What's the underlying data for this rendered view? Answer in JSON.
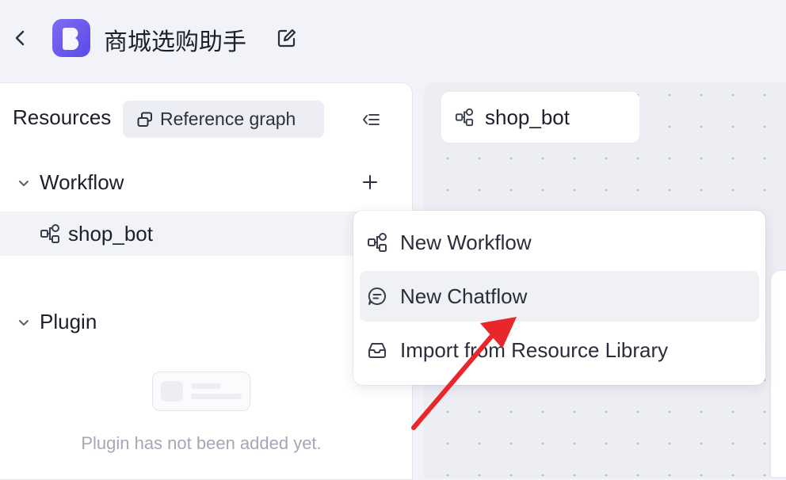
{
  "header": {
    "app_title": "商城选购助手"
  },
  "sidebar": {
    "title": "Resources",
    "reference_graph_label": "Reference graph",
    "sections": [
      {
        "label": "Workflow",
        "items": [
          {
            "label": "shop_bot"
          }
        ]
      },
      {
        "label": "Plugin",
        "empty_text": "Plugin has not been added yet."
      }
    ]
  },
  "canvas": {
    "tab_label": "shop_bot"
  },
  "add_menu": {
    "items": [
      {
        "label": "New Workflow",
        "icon": "workflow-icon"
      },
      {
        "label": "New Chatflow",
        "icon": "chat-icon",
        "highlighted": true
      },
      {
        "label": "Import from Resource Library",
        "icon": "inbox-icon"
      }
    ]
  },
  "annotation": {
    "color": "#e8262b",
    "target": "New Chatflow"
  },
  "colors": {
    "accent": "#6554ec"
  }
}
